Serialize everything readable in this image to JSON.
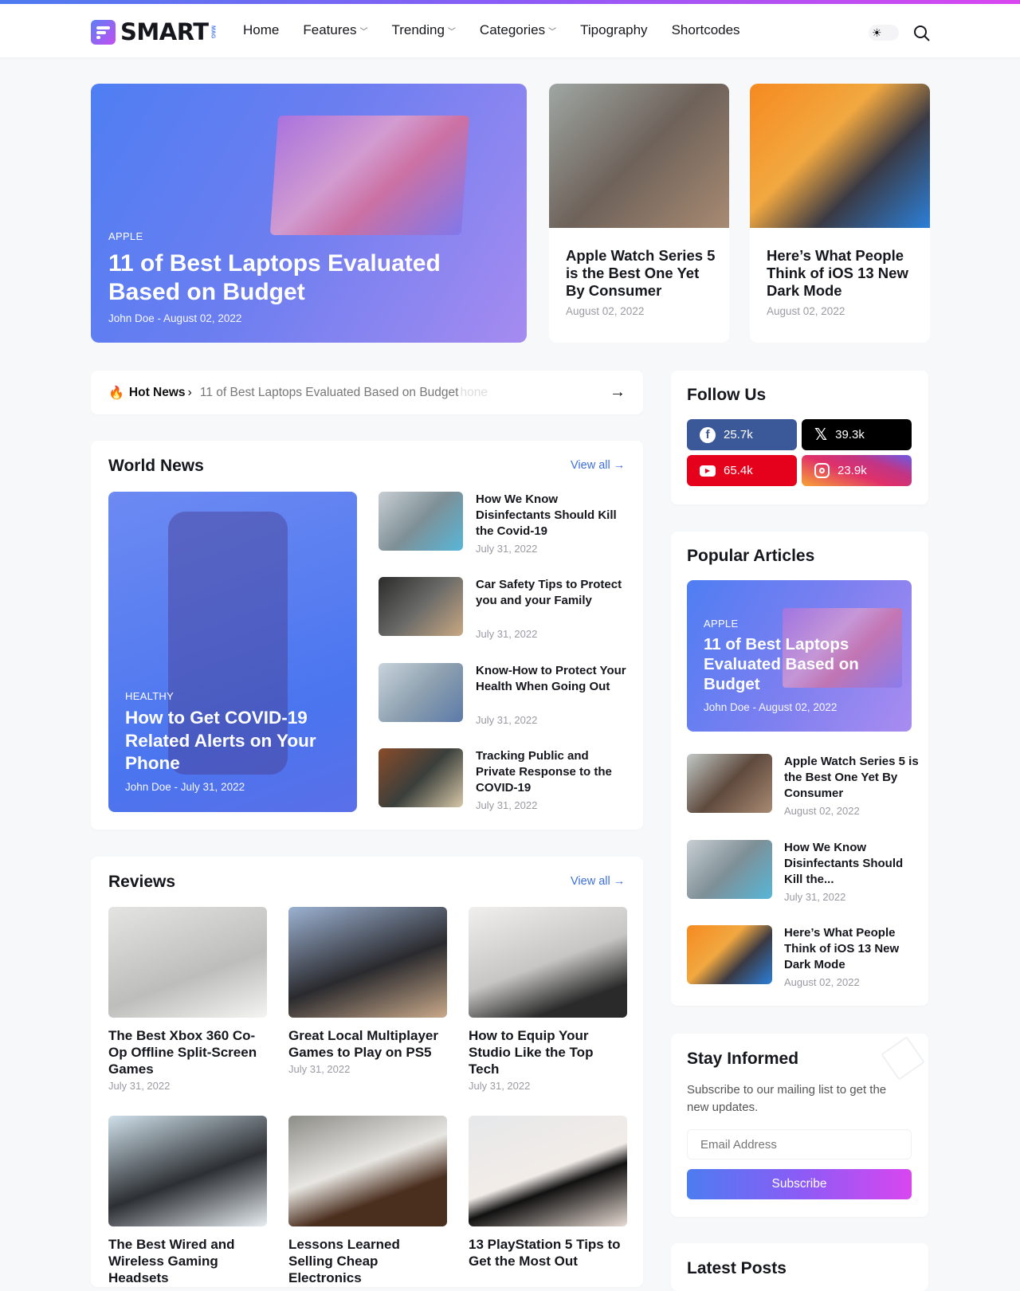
{
  "header": {
    "logo_text": "SMART",
    "logo_sub": "MAG",
    "nav": [
      {
        "label": "Home",
        "dropdown": false
      },
      {
        "label": "Features",
        "dropdown": true
      },
      {
        "label": "Trending",
        "dropdown": true
      },
      {
        "label": "Categories",
        "dropdown": true
      },
      {
        "label": "Tipography",
        "dropdown": false
      },
      {
        "label": "Shortcodes",
        "dropdown": false
      }
    ],
    "theme_icon": "sun-icon",
    "search_icon": "search-icon"
  },
  "hero": {
    "main": {
      "category": "APPLE",
      "title": "11 of Best Laptops Evaluated Based on Budget",
      "meta": "John Doe - August 02, 2022"
    },
    "side": [
      {
        "title": "Apple Watch Series 5 is the Best One Yet By Consumer",
        "date": "August 02, 2022"
      },
      {
        "title": "Here’s What People Think of iOS 13 New Dark Mode",
        "date": "August 02, 2022"
      }
    ]
  },
  "ticker": {
    "label": "Hot News",
    "text": "11 of Best Laptops Evaluated Based on Budget",
    "trailing": "hone"
  },
  "world_news": {
    "title": "World News",
    "view_all": "View all →",
    "feature": {
      "category": "HEALTHY",
      "title": "How to Get COVID-19 Related Alerts on Your Phone",
      "meta": "John Doe - July 31, 2022"
    },
    "items": [
      {
        "title": "How We Know Disinfectants Should Kill the Covid-19",
        "date": "July 31, 2022"
      },
      {
        "title": "Car Safety Tips to Protect you and your Family",
        "date": "July 31, 2022"
      },
      {
        "title": "Know-How to Protect Your Health When Going Out",
        "date": "July 31, 2022"
      },
      {
        "title": "Tracking Public and Private Response to the COVID-19",
        "date": "July 31, 2022"
      }
    ]
  },
  "reviews": {
    "title": "Reviews",
    "view_all": "View all →",
    "items": [
      {
        "title": "The Best Xbox 360 Co-Op Offline Split-Screen Games",
        "date": "July 31, 2022"
      },
      {
        "title": "Great Local Multiplayer Games to Play on PS5",
        "date": "July 31, 2022"
      },
      {
        "title": "How to Equip Your Studio Like the Top Tech",
        "date": "July 31, 2022"
      },
      {
        "title": "The Best Wired and Wireless Gaming Headsets",
        "date": ""
      },
      {
        "title": "Lessons Learned Selling Cheap Electronics",
        "date": ""
      },
      {
        "title": "13 PlayStation 5 Tips to Get the Most Out",
        "date": ""
      }
    ]
  },
  "follow": {
    "title": "Follow Us",
    "networks": [
      {
        "name": "facebook",
        "count": "25.7k",
        "color": "#3b5998"
      },
      {
        "name": "x",
        "count": "39.3k",
        "color": "#000000"
      },
      {
        "name": "youtube",
        "count": "65.4k",
        "color": "#e5001c"
      },
      {
        "name": "instagram",
        "count": "23.9k",
        "color": "#c13584"
      }
    ]
  },
  "popular": {
    "title": "Popular Articles",
    "feature": {
      "category": "APPLE",
      "title": "11 of Best Laptops Evaluated Based on Budget",
      "meta": "John Doe - August 02, 2022"
    },
    "items": [
      {
        "title": "Apple Watch Series 5 is the Best One Yet By Consumer",
        "date": "August 02, 2022"
      },
      {
        "title": "How We Know Disinfectants Should Kill the...",
        "date": "July 31, 2022"
      },
      {
        "title": "Here’s What People Think of iOS 13 New Dark Mode",
        "date": "August 02, 2022"
      }
    ]
  },
  "newsletter": {
    "title": "Stay Informed",
    "text": "Subscribe to our mailing list to get the new updates.",
    "placeholder": "Email Address",
    "button": "Subscribe"
  },
  "latest": {
    "title": "Latest Posts"
  },
  "colors": {
    "accent": "#3d6fd9",
    "gradient_start": "#4d7cf0",
    "gradient_end": "#d946ef"
  }
}
